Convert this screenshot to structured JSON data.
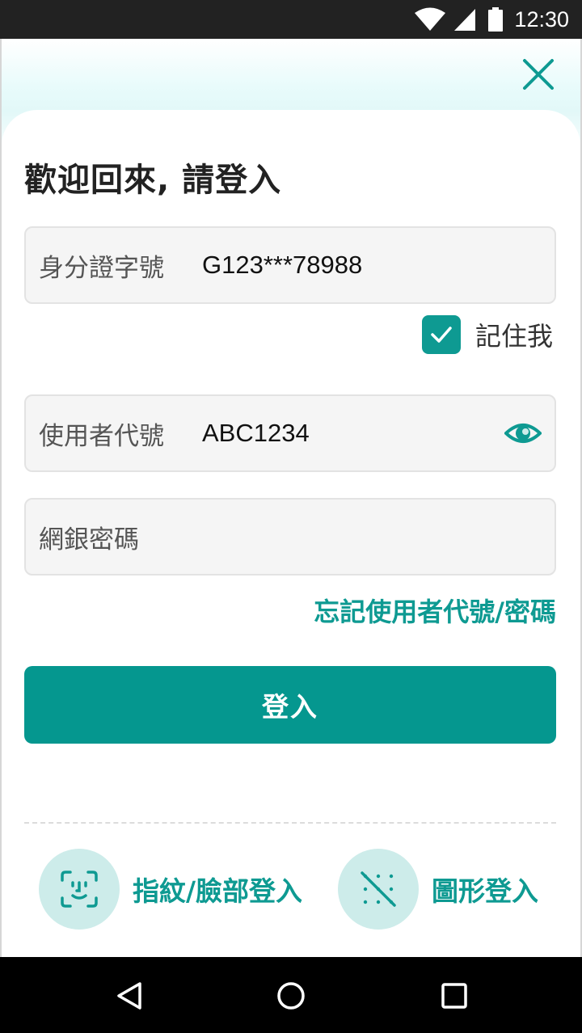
{
  "status_bar": {
    "time": "12:30",
    "icons": [
      "wifi-icon",
      "cell-signal-icon",
      "battery-icon"
    ]
  },
  "header": {
    "close_icon": "close-icon"
  },
  "title": "歡迎回來, 請登入",
  "fields": {
    "id_number": {
      "label": "身分證字號",
      "value": "G123***78988"
    },
    "user_code": {
      "label": "使用者代號",
      "value": "ABC1234",
      "toggle_icon": "eye-icon"
    },
    "password": {
      "label": "網銀密碼",
      "value": ""
    }
  },
  "remember_me": {
    "label": "記住我",
    "checked": true
  },
  "forgot_link": "忘記使用者代號/密碼",
  "login_button": "登入",
  "alt_logins": [
    {
      "label": "指紋/臉部登入",
      "icon": "face-id-icon"
    },
    {
      "label": "圖形登入",
      "icon": "pattern-lock-icon"
    }
  ],
  "nav_bar": {
    "buttons": [
      "back-icon",
      "home-icon",
      "recents-icon"
    ]
  },
  "colors": {
    "accent": "#05978f",
    "accent_light": "#cdecea",
    "status_bar": "#222222",
    "nav_bar": "#000000"
  }
}
